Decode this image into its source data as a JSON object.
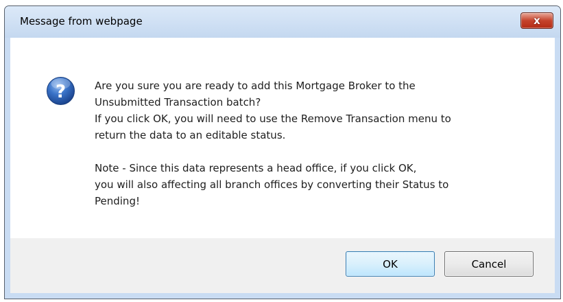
{
  "dialog": {
    "title": "Message from webpage",
    "close_label": "x",
    "icon": "question-icon",
    "message_lines": [
      "Are you sure you are ready to add this Mortgage Broker to the",
      "Unsubmitted Transaction batch?",
      "If you click OK, you will need to use the Remove Transaction menu to",
      "return the data to an editable status.",
      "",
      "Note - Since this data represents a head office, if you click OK,",
      "you will also affecting all branch offices by converting their Status to",
      "Pending!"
    ],
    "ok_label": "OK",
    "cancel_label": "Cancel"
  },
  "colors": {
    "close_button": "#c5432c",
    "default_button_border": "#3c7fb1",
    "icon_blue": "#2a5fb0"
  }
}
